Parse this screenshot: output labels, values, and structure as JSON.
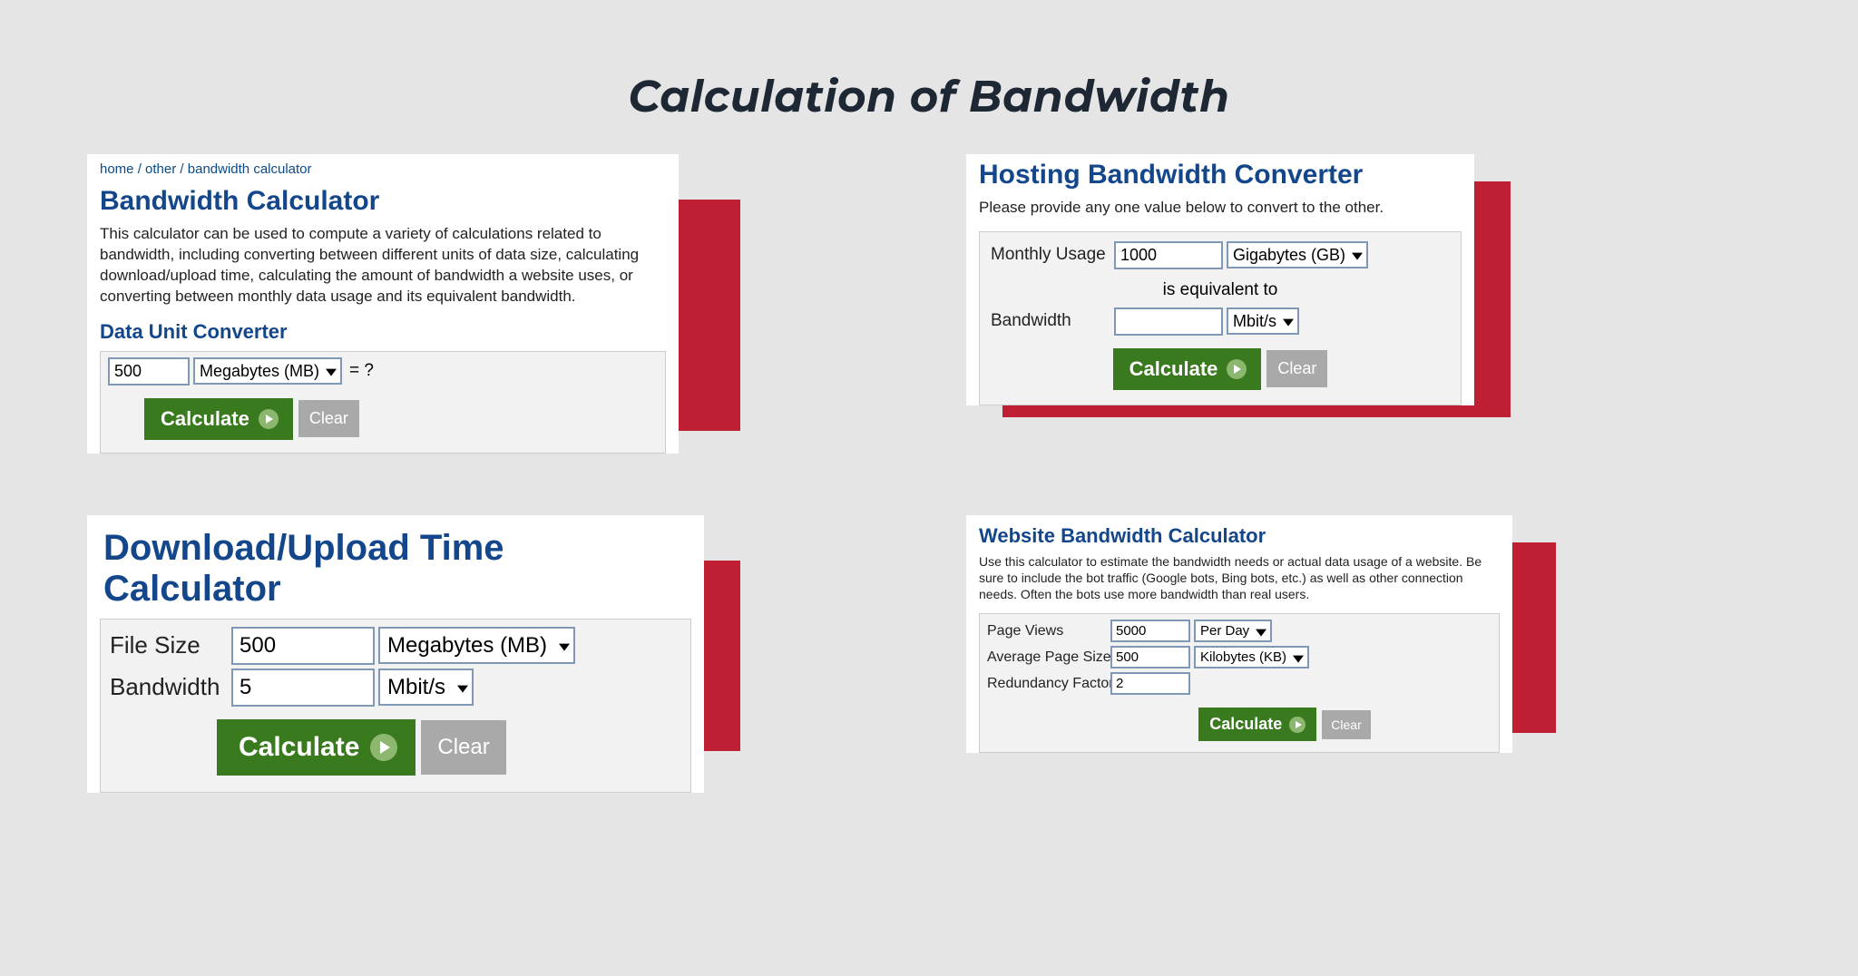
{
  "page_title": "Calculation of Bandwidth",
  "card1": {
    "breadcrumb": {
      "home": "home",
      "sep1": " / ",
      "other": "other",
      "sep2": " / ",
      "current": "bandwidth calculator"
    },
    "title": "Bandwidth Calculator",
    "desc": "This calculator can be used to compute a variety of calculations related to bandwidth, including converting between different units of data size, calculating download/upload time, calculating the amount of bandwidth a website uses, or converting between monthly data usage and its equivalent bandwidth.",
    "subheading": "Data Unit Converter",
    "value": "500",
    "unit": "Megabytes (MB)",
    "equals": "= ?",
    "calculate": "Calculate",
    "clear": "Clear"
  },
  "card2": {
    "title": "Hosting Bandwidth Converter",
    "desc": "Please provide any one value below to convert to the other.",
    "monthly_label": "Monthly Usage",
    "monthly_value": "1000",
    "monthly_unit": "Gigabytes (GB)",
    "equiv": "is equivalent to",
    "bandwidth_label": "Bandwidth",
    "bandwidth_value": "",
    "bandwidth_unit": "Mbit/s",
    "calculate": "Calculate",
    "clear": "Clear"
  },
  "card3": {
    "title": "Download/Upload Time Calculator",
    "filesize_label": "File Size",
    "filesize_value": "500",
    "filesize_unit": "Megabytes (MB)",
    "bandwidth_label": "Bandwidth",
    "bandwidth_value": "5",
    "bandwidth_unit": "Mbit/s",
    "calculate": "Calculate",
    "clear": "Clear"
  },
  "card4": {
    "title": "Website Bandwidth Calculator",
    "desc": "Use this calculator to estimate the bandwidth needs or actual data usage of a website. Be sure to include the bot traffic (Google bots, Bing bots, etc.) as well as other connection needs. Often the bots use more bandwidth than real users.",
    "pageviews_label": "Page Views",
    "pageviews_value": "5000",
    "pageviews_unit": "Per Day",
    "pagesize_label": "Average Page Size",
    "pagesize_value": "500",
    "pagesize_unit": "Kilobytes (KB)",
    "redundancy_label": "Redundancy Factor",
    "redundancy_value": "2",
    "calculate": "Calculate",
    "clear": "Clear"
  }
}
